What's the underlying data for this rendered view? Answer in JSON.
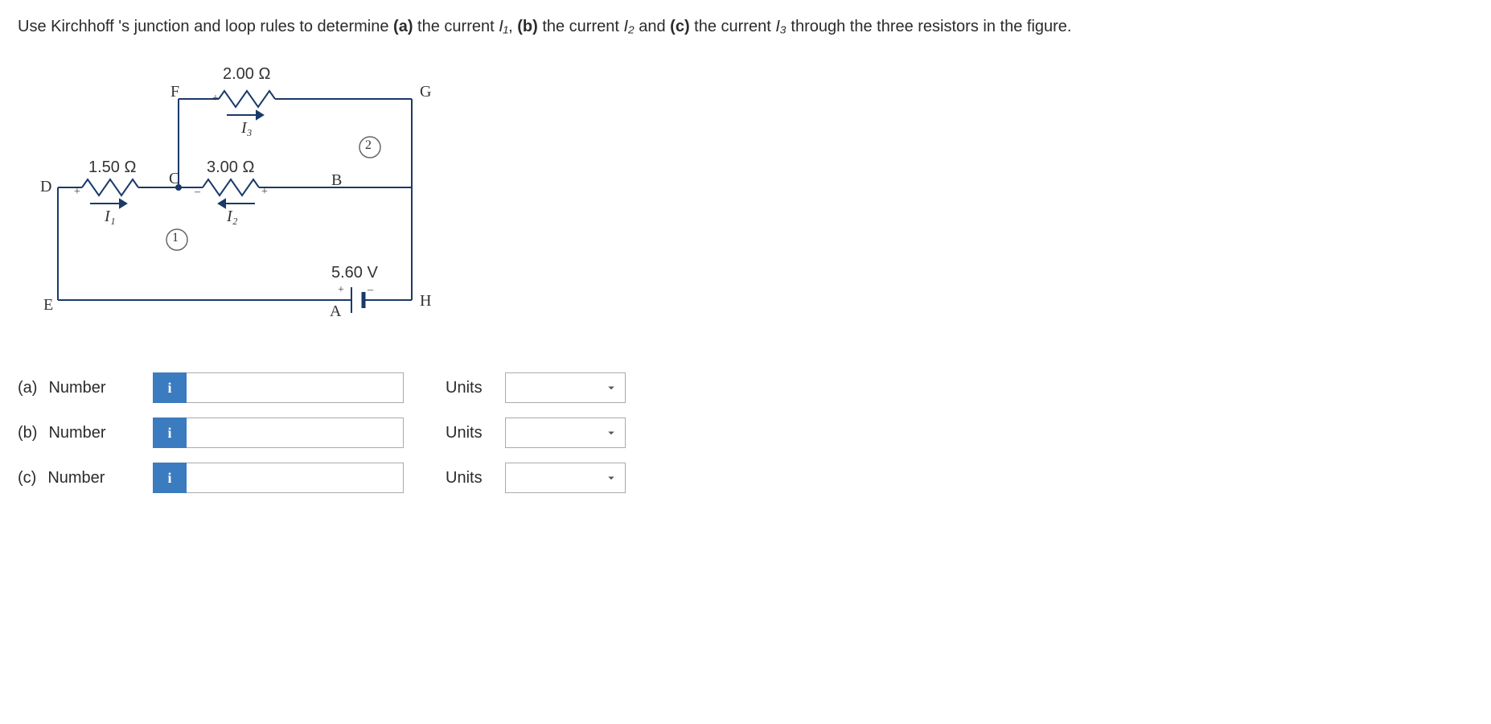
{
  "question": {
    "prefix": "Use Kirchhoff 's junction and loop rules to determine ",
    "partA": "(a)",
    "textA": " the current ",
    "currentA": "I₁",
    "commaA": ", ",
    "partB": "(b)",
    "textB": " the current ",
    "currentB": "I₂",
    "andText": " and ",
    "partC": "(c)",
    "textC": " the current ",
    "currentC": "I₃",
    "suffix": " through the three resistors in the figure."
  },
  "circuit": {
    "nodeF": "F",
    "nodeG": "G",
    "nodeD": "D",
    "nodeC": "C",
    "nodeB": "B",
    "nodeE": "E",
    "nodeA": "A",
    "nodeH": "H",
    "r1": "1.50 Ω",
    "r2": "3.00 Ω",
    "r3": "2.00 Ω",
    "v": "5.60 V",
    "i1": "I₁",
    "i2": "I₂",
    "i3": "I₃",
    "loop1": "1",
    "loop2": "2",
    "plus": "+",
    "minus": "–"
  },
  "answers": {
    "a": {
      "part": "(a)",
      "label": "Number",
      "units": "Units"
    },
    "b": {
      "part": "(b)",
      "label": "Number",
      "units": "Units"
    },
    "c": {
      "part": "(c)",
      "label": "Number",
      "units": "Units"
    }
  },
  "icon": "i"
}
